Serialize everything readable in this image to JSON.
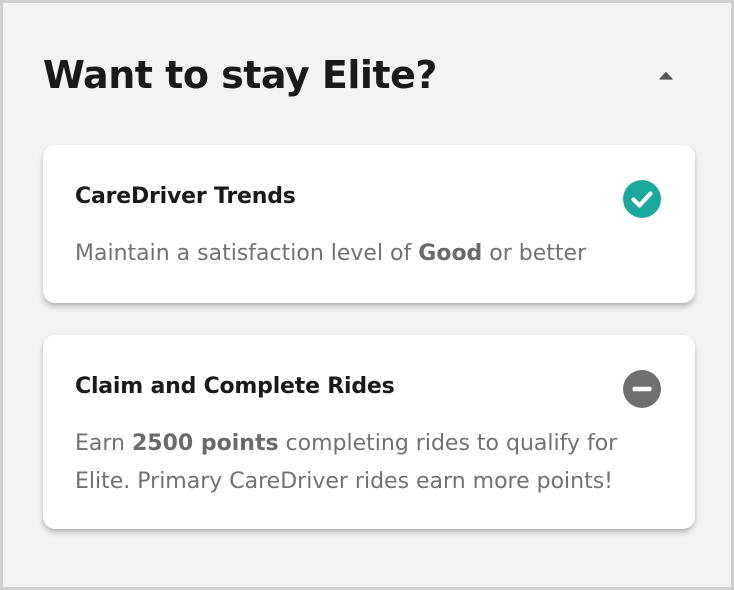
{
  "header": {
    "title": "Want to stay Elite?",
    "toggle_icon": "caret-up-icon"
  },
  "cards": [
    {
      "title": "CareDriver Trends",
      "status": "complete",
      "status_icon": "check-circle-icon",
      "status_color": "#1aa89c",
      "body": {
        "before": "Maintain a satisfaction level of ",
        "bold": "Good",
        "after": " or better"
      }
    },
    {
      "title": "Claim and Complete Rides",
      "status": "incomplete",
      "status_icon": "minus-circle-icon",
      "status_color": "#707070",
      "body": {
        "before": "Earn ",
        "bold": "2500 points",
        "after": " completing rides to qualify for Elite. Primary CareDriver rides earn more points!"
      }
    }
  ]
}
